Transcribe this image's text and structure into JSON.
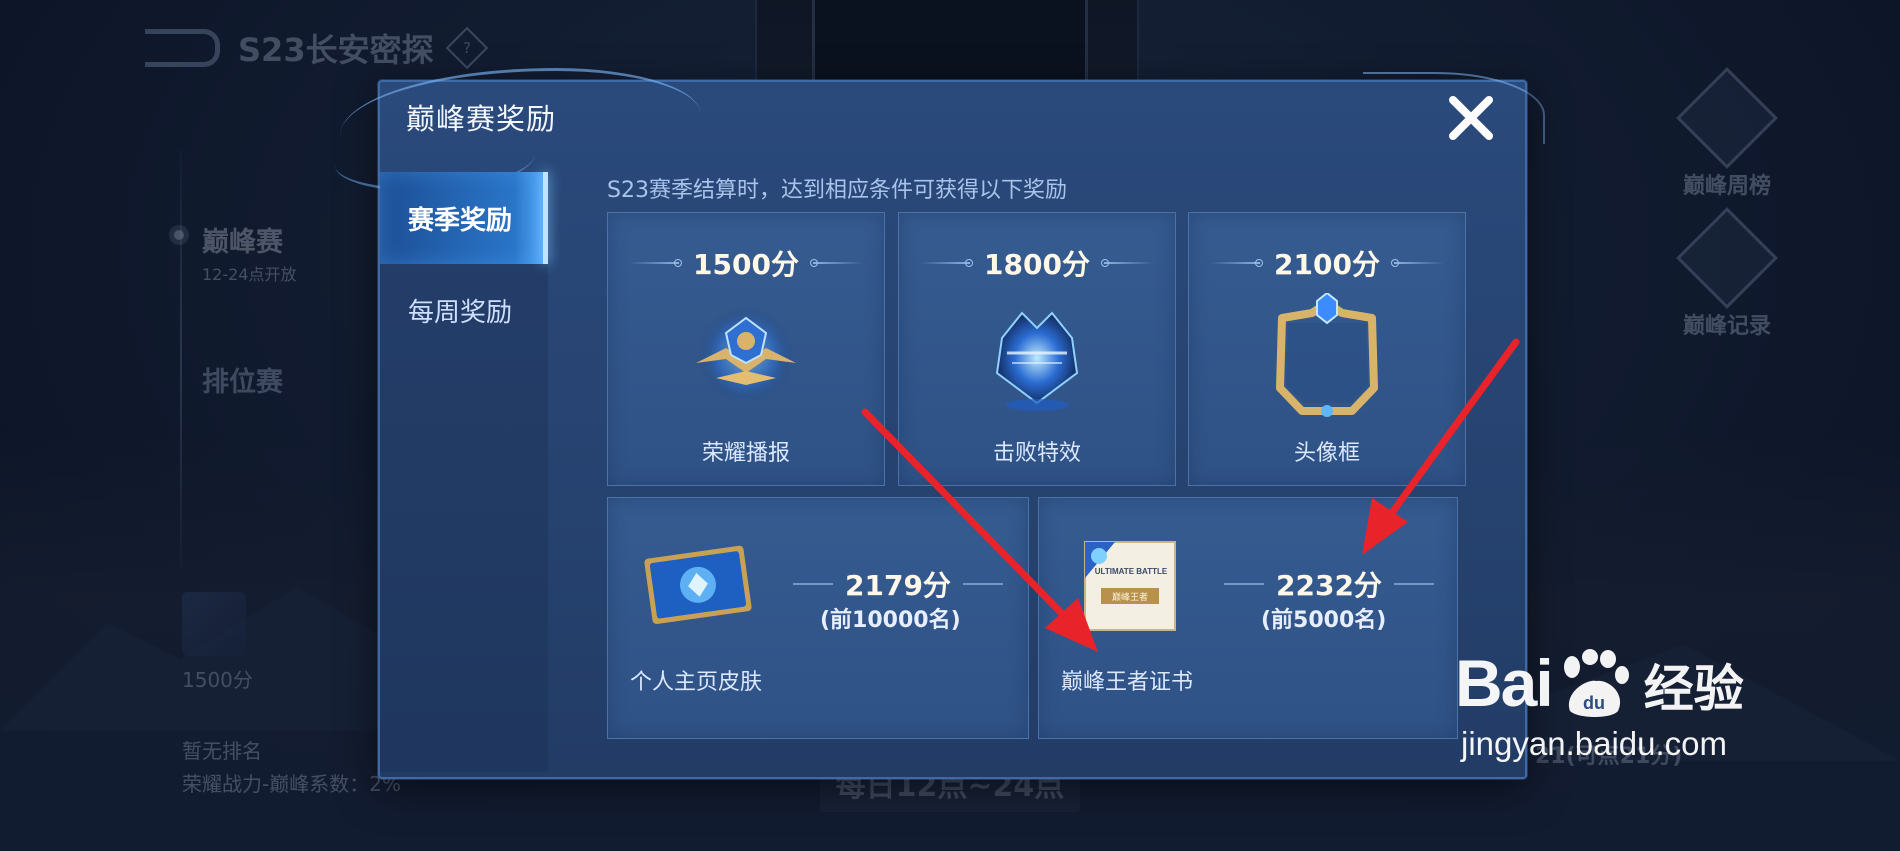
{
  "background": {
    "season_title": "S23长安密探",
    "help_icon": "question-diamond-icon",
    "nav": {
      "peak_match": "巅峰赛",
      "peak_time": "12-24点开放",
      "rank_match": "排位赛"
    },
    "left_bottom": {
      "score": "1500分",
      "rank_status": "暂无排名",
      "coefficient": "荣耀战力-巅峰系数：2%"
    },
    "right_nav": [
      "巅峰周榜",
      "巅峰记录"
    ],
    "bottom_bar": "每日12点~24点",
    "bottom_right": "21(可点21分)"
  },
  "modal": {
    "title": "巅峰赛奖励",
    "close_icon": "close-x-icon",
    "tabs": [
      {
        "label": "赛季奖励",
        "active": true
      },
      {
        "label": "每周奖励",
        "active": false
      }
    ],
    "subtitle": "S23赛季结算时，达到相应条件可获得以下奖励",
    "top_rewards": [
      {
        "score": "1500分",
        "label": "荣耀播报",
        "icon": "glory-broadcast-icon"
      },
      {
        "score": "1800分",
        "label": "击败特效",
        "icon": "defeat-effect-icon"
      },
      {
        "score": "2100分",
        "label": "头像框",
        "icon": "avatar-frame-icon"
      }
    ],
    "bottom_rewards": [
      {
        "score": "2179分",
        "rank": "(前10000名)",
        "label": "个人主页皮肤",
        "icon": "profile-skin-card-icon"
      },
      {
        "score": "2232分",
        "rank": "(前5000名)",
        "label": "巅峰王者证书",
        "icon": "peak-certificate-icon",
        "cert_text": "ULTIMATE BATTLE",
        "cert_sub": "巅峰王者"
      }
    ]
  },
  "annotations": {
    "arrow_color": "#e8232a"
  },
  "watermark": {
    "brand": "Bai",
    "brand_du": "du",
    "brand_cn": "经验",
    "url": "jingyan.baidu.com"
  }
}
